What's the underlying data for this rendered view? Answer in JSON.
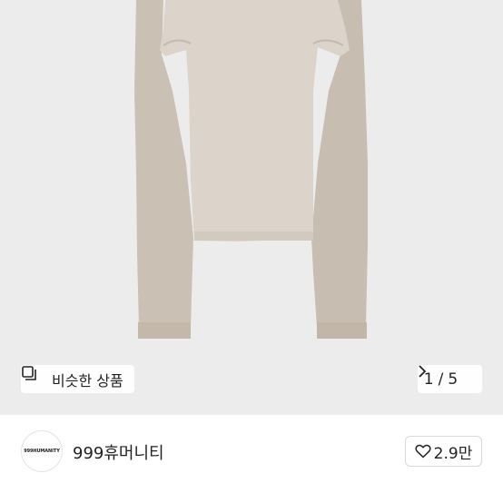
{
  "product_image": {
    "description_icon": "garment-photo"
  },
  "similar_products": {
    "label": "비슷한 상품",
    "icon": "similar-items-icon"
  },
  "pager": {
    "current": "1",
    "separator": "/",
    "total": "5",
    "icon": "chevron-right-icon"
  },
  "shop": {
    "name": "999휴머니티",
    "avatar_logo_text": "999HUMANITY",
    "avatar_icon": "shop-logo"
  },
  "like": {
    "count": "2.9만",
    "icon": "heart-outline-icon"
  }
}
